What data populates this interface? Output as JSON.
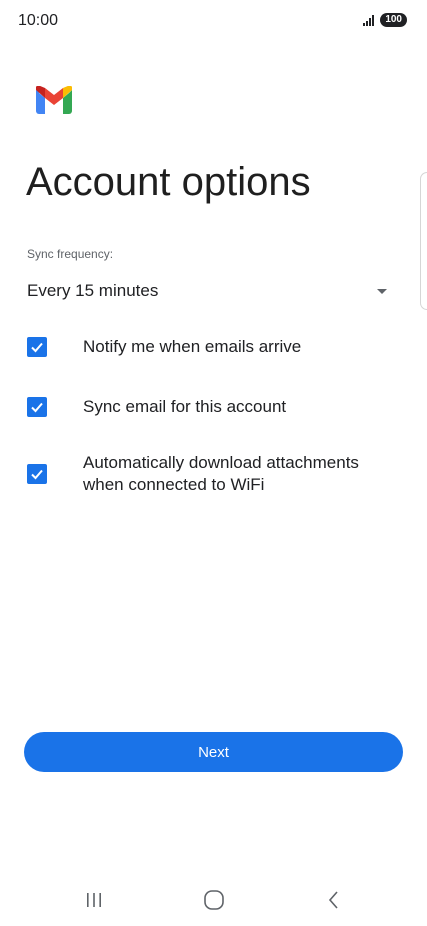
{
  "status_bar": {
    "time": "10:00",
    "battery": "100"
  },
  "app": {
    "logo_icon": "gmail-logo"
  },
  "page": {
    "title": "Account options"
  },
  "sync": {
    "label": "Sync frequency:",
    "selected_value": "Every 15 minutes"
  },
  "options": [
    {
      "label": "Notify me when emails arrive",
      "checked": true
    },
    {
      "label": "Sync email for this account",
      "checked": true
    },
    {
      "label": "Automatically download attachments when connected to WiFi",
      "checked": true
    }
  ],
  "actions": {
    "next_label": "Next"
  },
  "nav": {
    "recents_icon": "recents-icon",
    "home_icon": "home-icon",
    "back_icon": "back-icon"
  },
  "colors": {
    "accent": "#1a73e8",
    "text": "#202124",
    "secondary_text": "#5f6368"
  }
}
